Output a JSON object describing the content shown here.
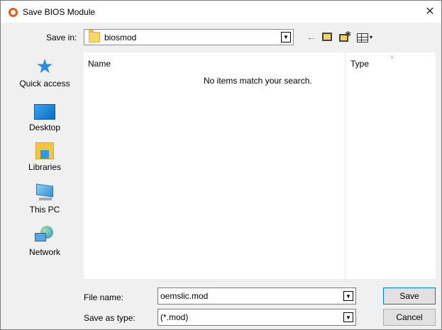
{
  "window": {
    "title": "Save BIOS Module",
    "close_label": "✕",
    "app_icon": "program-ring-icon",
    "accent_color": "#e8591a"
  },
  "savein": {
    "label": "Save in:",
    "value": "biosmod"
  },
  "toolbar": {
    "back_icon": "←",
    "view_arrow": "▾"
  },
  "places": [
    {
      "label": "Quick access",
      "icon": "quick-access-star-icon"
    },
    {
      "label": "Desktop",
      "icon": "desktop-icon"
    },
    {
      "label": "Libraries",
      "icon": "libraries-icon"
    },
    {
      "label": "This PC",
      "icon": "this-pc-icon"
    },
    {
      "label": "Network",
      "icon": "network-icon"
    }
  ],
  "filelist": {
    "columns": {
      "name": "Name",
      "type": "Type"
    },
    "empty_message": "No items match your search."
  },
  "form": {
    "filename_label": "File name:",
    "filename_value": "oemslic.mod",
    "savetype_label": "Save as type:",
    "savetype_value": "(*.mod)"
  },
  "buttons": {
    "save": "Save",
    "cancel": "Cancel"
  }
}
